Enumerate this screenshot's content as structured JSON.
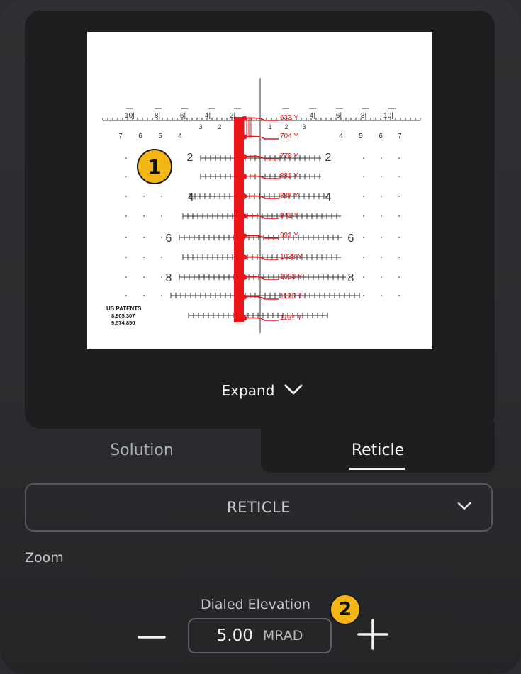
{
  "reticle_view": {
    "expand_label": "Expand",
    "hold_labels": [
      "633 Y",
      "704 Y",
      "770 Y",
      "831 Y",
      "887 Y",
      "941 Y",
      "991 Y",
      "1038 Y",
      "1083 Y",
      "1126 Y",
      "1167 Y"
    ],
    "top_scale_labels": [
      "10",
      "8",
      "6",
      "4",
      "2",
      "4",
      "6",
      "8",
      "10"
    ],
    "second_row_left": [
      "7",
      "6",
      "5",
      "4",
      "3",
      "2"
    ],
    "second_row_right": [
      "1",
      "2",
      "3",
      "4",
      "5",
      "6",
      "7"
    ],
    "row_numbers": [
      "2",
      "4",
      "6",
      "8"
    ],
    "patents": [
      "US PATENTS",
      "8,905,307",
      "9,574,850"
    ],
    "hold_color": "#e8161b"
  },
  "tabs": {
    "solution": "Solution",
    "reticle": "Reticle",
    "active": "Reticle"
  },
  "reticle_select": {
    "value": "RETICLE",
    "icon": "chevron-down-icon"
  },
  "zoom": {
    "label": "Zoom"
  },
  "dialed_elevation": {
    "label": "Dialed Elevation",
    "value": "5.00",
    "unit": "MRAD"
  },
  "annotations": {
    "badge_1": "1",
    "badge_2": "2",
    "color": "#f3b617"
  }
}
